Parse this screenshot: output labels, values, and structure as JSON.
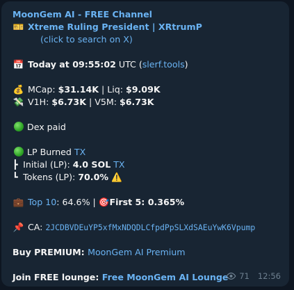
{
  "message": {
    "channel_name": "MoonGem AI - FREE Channel",
    "title_emoji": "🎫",
    "token_title": "Xtreme Ruling President | XRtrumP",
    "search_hint": "(click to search on X)",
    "date_emoji": "📅",
    "time_text": "Today at 09:55:02",
    "time_zone": " UTC (",
    "time_source": "slerf.tools",
    "time_close": ")",
    "money_emoji": "💰",
    "mcap_label": "MCap: ",
    "mcap_value": "$31.14K",
    "sep1": " | Liq: ",
    "liq_value": "$9.09K",
    "vol_emoji": "💸",
    "v1h_label": "V1H: ",
    "v1h_value": "$6.73K",
    "sep2": " | V5M: ",
    "v5m_value": "$6.73K",
    "dex_text": "Dex paid",
    "lp_burned_label": "LP Burned ",
    "lp_tx": "TX",
    "initial_prefix": "┣ ",
    "initial_label": "Initial (LP): ",
    "initial_value": "4.0 SOL",
    "initial_tx": "TX",
    "tokens_prefix": "┗ ",
    "tokens_label": "Tokens (LP): ",
    "tokens_value": "70.0%",
    "warning_emoji": "⚠️",
    "top_emoji": "💼",
    "top10_label": "Top 10",
    "top10_value": ": 64.6% | ",
    "target_emoji": "🎯",
    "first5_text": "First 5: 0.365%",
    "pin_emoji": "📌",
    "ca_label": "CA: ",
    "ca_value": "2JCDBVDEuYP5xfMxNDQDLCfpdPpSLXdSAEuYwK6Vpump",
    "premium_label": "Buy PREMIUM: ",
    "premium_link": "MoonGem AI Premium",
    "lounge_label": "Join FREE lounge: ",
    "lounge_link": "Free MoonGem AI Lounge",
    "views": "71",
    "time": "12:56"
  },
  "colors": {
    "background": "#0e1621",
    "bubble": "#182533",
    "link": "#6ab3f3",
    "meta": "#6d7f8f"
  }
}
